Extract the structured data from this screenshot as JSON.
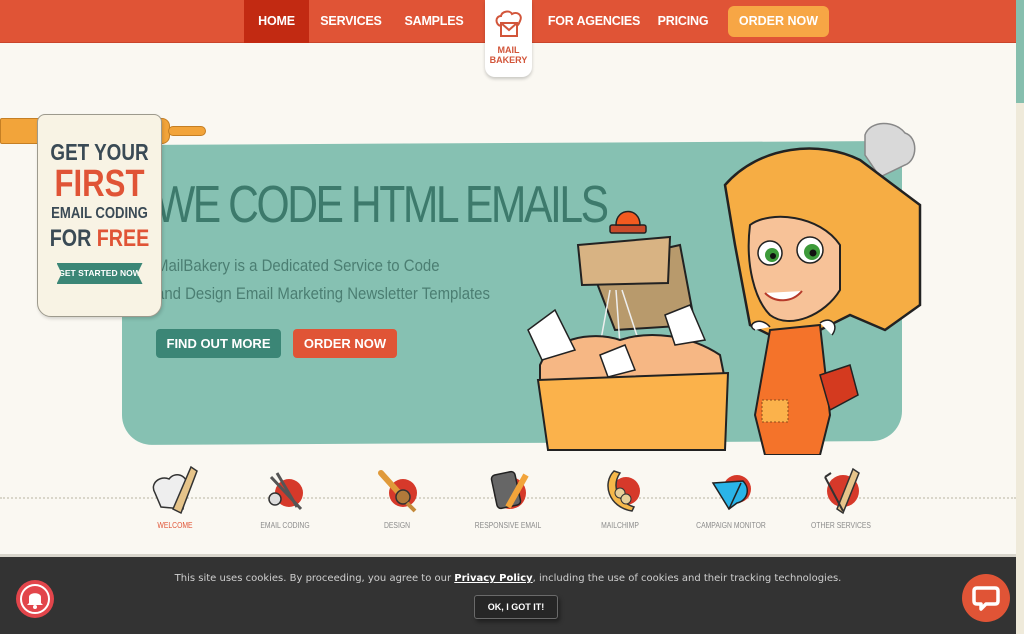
{
  "nav": {
    "items": [
      {
        "label": "HOME",
        "active": true
      },
      {
        "label": "SERVICES",
        "active": false
      },
      {
        "label": "SAMPLES",
        "active": false
      },
      {
        "label": "FOR AGENCIES",
        "active": false
      },
      {
        "label": "PRICING",
        "active": false
      }
    ],
    "order_label": "ORDER NOW",
    "logo_line1": "MAIL",
    "logo_line2": "BAKERY"
  },
  "banner": {
    "line1": "GET YOUR",
    "line2": "FIRST",
    "line3": "EMAIL CODING",
    "line4_a": "FOR",
    "line4_b": "FREE",
    "cta": "GET STARTED NOW"
  },
  "hero": {
    "title": "WE CODE HTML EMAILS",
    "subtitle_line1": "MailBakery is a Dedicated Service to Code",
    "subtitle_line2": "and Design Email Marketing Newsletter Templates",
    "find_out_more": "FIND OUT MORE",
    "order_now": "ORDER NOW"
  },
  "services": [
    {
      "label": "WELCOME",
      "icon": "chef-hat-rolling-pin-icon",
      "active": true
    },
    {
      "label": "EMAIL CODING",
      "icon": "scissors-wrench-icon",
      "active": false
    },
    {
      "label": "DESIGN",
      "icon": "paintbrush-icon",
      "active": false
    },
    {
      "label": "RESPONSIVE EMAIL",
      "icon": "phone-pencil-icon",
      "active": false
    },
    {
      "label": "MAILCHIMP",
      "icon": "banana-icon",
      "active": false
    },
    {
      "label": "CAMPAIGN MONITOR",
      "icon": "campaign-monitor-icon",
      "active": false
    },
    {
      "label": "OTHER SERVICES",
      "icon": "compass-ruler-icon",
      "active": false
    }
  ],
  "cookie": {
    "text_before": "This site uses cookies. By proceeding, you agree to our ",
    "link": "Privacy Policy",
    "text_after": ", including the use of cookies and their tracking technologies.",
    "ok_label": "OK, I GOT IT!"
  },
  "colors": {
    "brand_red": "#e05436",
    "nav_active": "#c22a12",
    "order_orange": "#f7a645",
    "teal_panel": "#86c1b2",
    "teal_button": "#3b8676"
  }
}
